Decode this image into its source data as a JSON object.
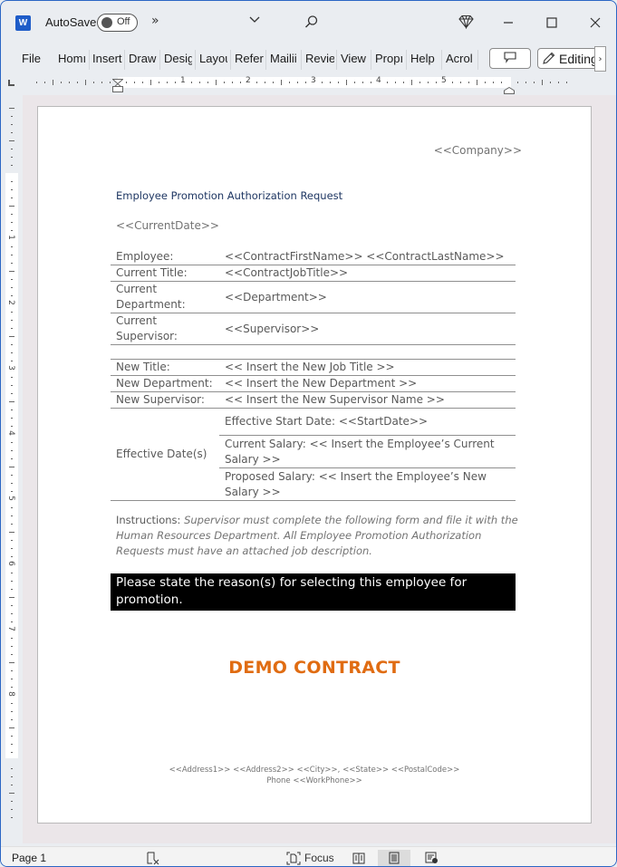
{
  "titlebar": {
    "app_icon": "word-icon",
    "app_icon_letter": "W",
    "autosave_label": "AutoSave",
    "autosave_state": "Off",
    "overflow_glyph": "»",
    "dropdown_glyph": "⌄",
    "search_icon": "search-icon",
    "premium_icon": "diamond-icon",
    "minimize_glyph": "—",
    "maximize_glyph": "☐",
    "close_glyph": "✕"
  },
  "ribbon": {
    "tabs": [
      "File",
      "Homı",
      "Insert",
      "Draw",
      "Desig",
      "Layou",
      "Refer",
      "Mailii",
      "Revie",
      "View",
      "Propı",
      "Help",
      "Acrol"
    ],
    "comment_icon": "comment-icon",
    "editing_label": "Editing",
    "more_glyph": "›"
  },
  "ruler": {
    "h_numbers": [
      "1",
      "2",
      "3",
      "4",
      "5"
    ],
    "v_numbers": [
      "1",
      "2",
      "3",
      "4",
      "5",
      "6",
      "7",
      "8"
    ]
  },
  "document": {
    "company": "<<Company>>",
    "title": "Employee Promotion Authorization Request",
    "current_date": "<<CurrentDate>>",
    "current_info": [
      {
        "label": "Employee:",
        "value": "<<ContractFirstName>> <<ContractLastName>>"
      },
      {
        "label": "Current Title:",
        "value": "<<ContractJobTitle>>"
      },
      {
        "label": "Current Department:",
        "value": "<<Department>>"
      },
      {
        "label": "Current Supervisor:",
        "value": "<<Supervisor>>"
      }
    ],
    "new_info": [
      {
        "label": "New Title:",
        "value": "<< Insert the New Job Title >>"
      },
      {
        "label": "New Department:",
        "value": "<< Insert the New Department >>"
      },
      {
        "label": "New Supervisor:",
        "value": "<< Insert the New Supervisor Name >>"
      }
    ],
    "effective": {
      "label": "Effective Date(s)",
      "items": [
        "Effective Start Date: <<StartDate>>",
        "Current Salary: << Insert the Employee’s Current Salary >>",
        "Proposed Salary: << Insert the Employee’s New Salary >>"
      ]
    },
    "instructions_label": "Instructions:",
    "instructions_body": " Supervisor must complete the following form and file it with the Human Resources Department. All Employee Promotion Authorization Requests must have an attached job description.",
    "reason_prompt": "Please state the reason(s) for selecting this employee for promotion.",
    "watermark": "DEMO CONTRACT",
    "footer_line1": "<<Address1>> <<Address2>> <<City>>, <<State>> <<PostalCode>>",
    "footer_line2": "Phone <<WorkPhone>>"
  },
  "statusbar": {
    "page": "Page 1",
    "focus_label": "Focus",
    "active_view": "print-layout"
  },
  "colors": {
    "title_blue": "#1f3763",
    "demo_orange": "#e06c12",
    "window_border": "#2b66c4"
  }
}
